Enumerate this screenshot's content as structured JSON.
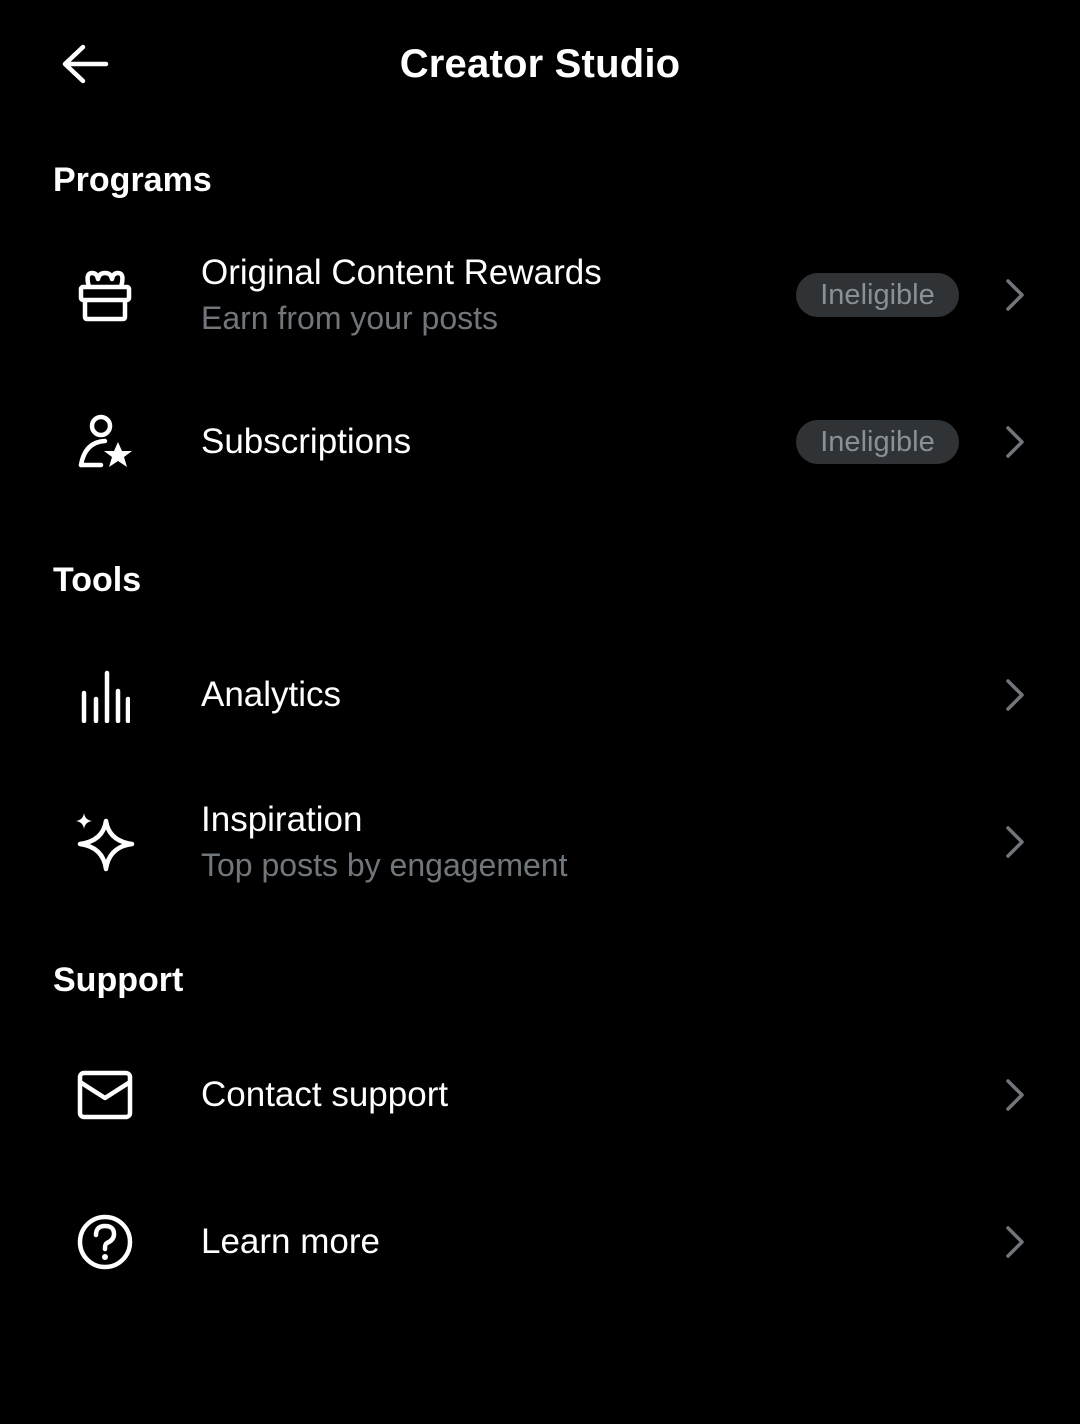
{
  "header": {
    "title": "Creator Studio",
    "back_icon": "arrow-left-icon"
  },
  "sections": {
    "programs": {
      "heading": "Programs",
      "items": [
        {
          "title": "Original Content Rewards",
          "subtitle": "Earn from your posts",
          "badge": "Ineligible",
          "icon": "gift-icon"
        },
        {
          "title": "Subscriptions",
          "badge": "Ineligible",
          "icon": "person-star-icon"
        }
      ]
    },
    "tools": {
      "heading": "Tools",
      "items": [
        {
          "title": "Analytics",
          "icon": "bar-chart-icon"
        },
        {
          "title": "Inspiration",
          "subtitle": "Top posts by engagement",
          "icon": "sparkle-icon"
        }
      ]
    },
    "support": {
      "heading": "Support",
      "items": [
        {
          "title": "Contact support",
          "icon": "envelope-icon"
        },
        {
          "title": "Learn more",
          "icon": "help-circle-icon"
        }
      ]
    }
  },
  "colors": {
    "background": "#000000",
    "text_primary": "#ffffff",
    "text_secondary": "#71767b",
    "badge_background": "#2f3336",
    "badge_text": "#8b9096",
    "chevron": "#71767b"
  }
}
